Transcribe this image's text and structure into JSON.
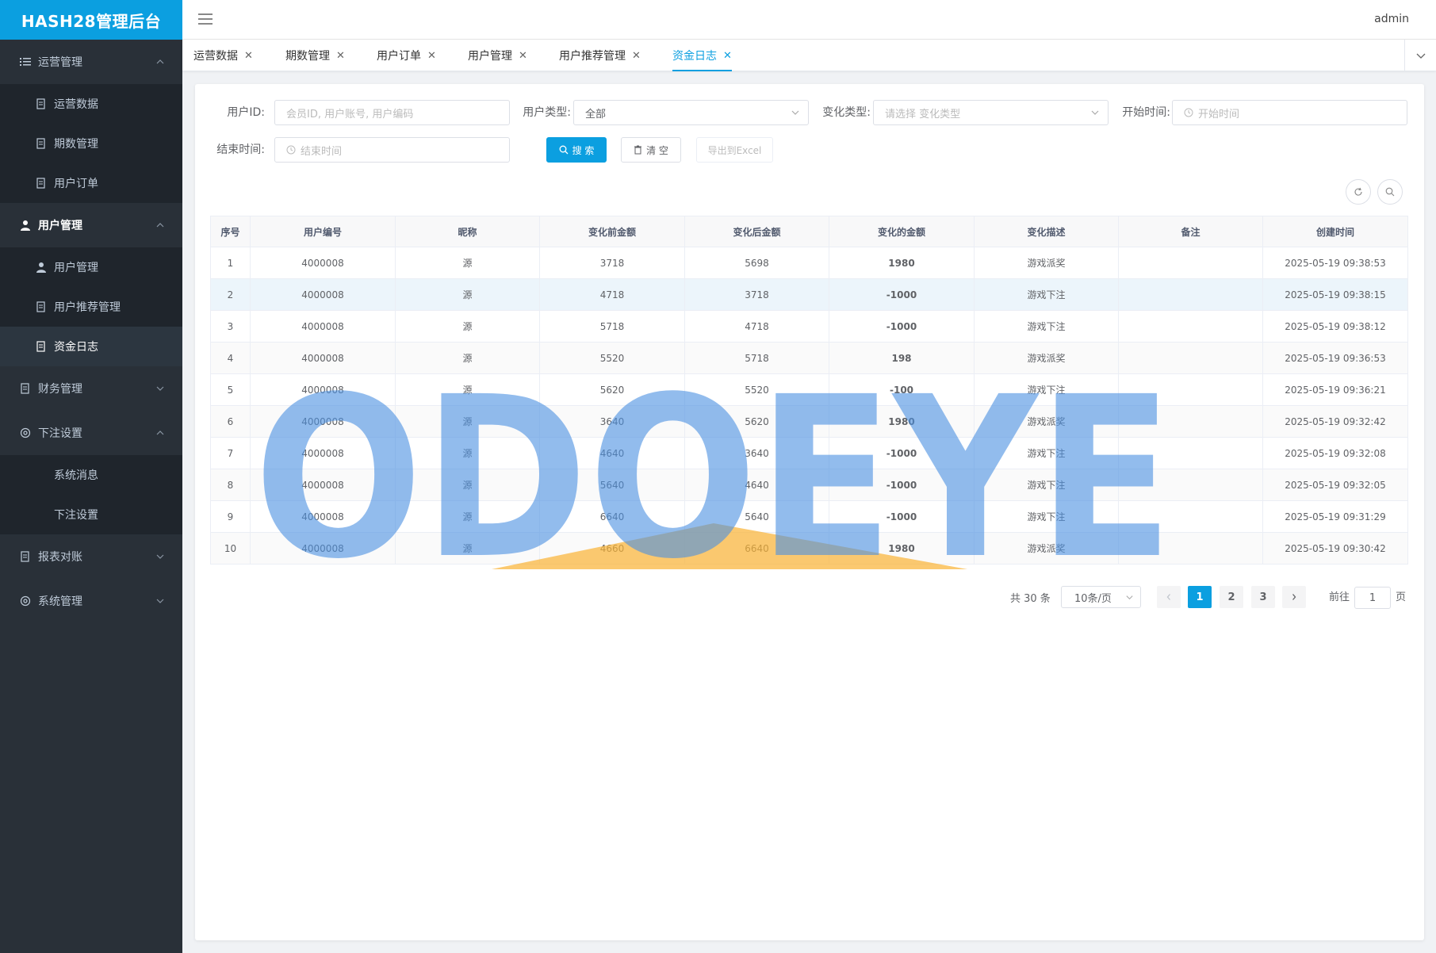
{
  "app": {
    "title": "HASH28管理后台",
    "user": "admin"
  },
  "sidebar": {
    "groups": [
      {
        "label": "运营管理",
        "icon": "list-icon",
        "expanded": true,
        "items": [
          {
            "label": "运营数据"
          },
          {
            "label": "期数管理"
          },
          {
            "label": "用户订单"
          }
        ]
      },
      {
        "label": "用户管理",
        "icon": "user-icon",
        "expanded": true,
        "active": true,
        "items": [
          {
            "label": "用户管理"
          },
          {
            "label": "用户推荐管理"
          },
          {
            "label": "资金日志",
            "active": true
          }
        ]
      },
      {
        "label": "财务管理",
        "icon": "document-icon",
        "expanded": false,
        "items": []
      },
      {
        "label": "下注设置",
        "icon": "gear-icon",
        "expanded": true,
        "items": [
          {
            "label": "系统消息"
          },
          {
            "label": "下注设置"
          }
        ]
      },
      {
        "label": "报表对账",
        "icon": "document-icon",
        "expanded": false,
        "items": []
      },
      {
        "label": "系统管理",
        "icon": "gear-icon",
        "expanded": false,
        "items": []
      }
    ]
  },
  "tabs": [
    {
      "label": "运营数据"
    },
    {
      "label": "期数管理"
    },
    {
      "label": "用户订单"
    },
    {
      "label": "用户管理"
    },
    {
      "label": "用户推荐管理"
    },
    {
      "label": "资金日志",
      "active": true
    }
  ],
  "filters": {
    "user_id": {
      "label": "用户ID:",
      "placeholder": "会员ID, 用户账号, 用户编码"
    },
    "user_type": {
      "label": "用户类型:",
      "value": "全部"
    },
    "change_type": {
      "label": "变化类型:",
      "placeholder": "请选择 变化类型"
    },
    "start_time": {
      "label": "开始时间:",
      "placeholder": "开始时间"
    },
    "end_time": {
      "label": "结束时间:",
      "placeholder": "结束时间"
    },
    "search_label": "搜 索",
    "clear_label": "清 空",
    "export_label": "导出到Excel"
  },
  "table": {
    "columns": [
      "序号",
      "用户编号",
      "昵称",
      "变化前金额",
      "变化后金额",
      "变化的金额",
      "变化描述",
      "备注",
      "创建时间"
    ],
    "rows": [
      {
        "no": "1",
        "user_no": "4000008",
        "nick": "源",
        "before": "3718",
        "after": "5698",
        "change": "1980",
        "desc": "游戏派奖",
        "note": "",
        "time": "2025-05-19 09:38:53"
      },
      {
        "no": "2",
        "user_no": "4000008",
        "nick": "源",
        "before": "4718",
        "after": "3718",
        "change": "-1000",
        "desc": "游戏下注",
        "note": "",
        "time": "2025-05-19 09:38:15"
      },
      {
        "no": "3",
        "user_no": "4000008",
        "nick": "源",
        "before": "5718",
        "after": "4718",
        "change": "-1000",
        "desc": "游戏下注",
        "note": "",
        "time": "2025-05-19 09:38:12"
      },
      {
        "no": "4",
        "user_no": "4000008",
        "nick": "源",
        "before": "5520",
        "after": "5718",
        "change": "198",
        "desc": "游戏派奖",
        "note": "",
        "time": "2025-05-19 09:36:53"
      },
      {
        "no": "5",
        "user_no": "4000008",
        "nick": "源",
        "before": "5620",
        "after": "5520",
        "change": "-100",
        "desc": "游戏下注",
        "note": "",
        "time": "2025-05-19 09:36:21"
      },
      {
        "no": "6",
        "user_no": "4000008",
        "nick": "源",
        "before": "3640",
        "after": "5620",
        "change": "1980",
        "desc": "游戏派奖",
        "note": "",
        "time": "2025-05-19 09:32:42"
      },
      {
        "no": "7",
        "user_no": "4000008",
        "nick": "源",
        "before": "4640",
        "after": "3640",
        "change": "-1000",
        "desc": "游戏下注",
        "note": "",
        "time": "2025-05-19 09:32:08"
      },
      {
        "no": "8",
        "user_no": "4000008",
        "nick": "源",
        "before": "5640",
        "after": "4640",
        "change": "-1000",
        "desc": "游戏下注",
        "note": "",
        "time": "2025-05-19 09:32:05"
      },
      {
        "no": "9",
        "user_no": "4000008",
        "nick": "源",
        "before": "6640",
        "after": "5640",
        "change": "-1000",
        "desc": "游戏下注",
        "note": "",
        "time": "2025-05-19 09:31:29"
      },
      {
        "no": "10",
        "user_no": "4000008",
        "nick": "源",
        "before": "4660",
        "after": "6640",
        "change": "1980",
        "desc": "游戏派奖",
        "note": "",
        "time": "2025-05-19 09:30:42"
      }
    ]
  },
  "pagination": {
    "total_text": "共 30 条",
    "page_size": "10条/页",
    "pages": [
      "1",
      "2",
      "3"
    ],
    "current_page": "1",
    "goto_label": "前往",
    "goto_value": "1",
    "page_suffix": "页"
  },
  "watermark": {
    "text": "ODOEYE"
  },
  "colors": {
    "accent": "#0b9fe0",
    "sidebar": "#293038",
    "positive": "#c0121b",
    "negative": "#1a9c4a"
  }
}
